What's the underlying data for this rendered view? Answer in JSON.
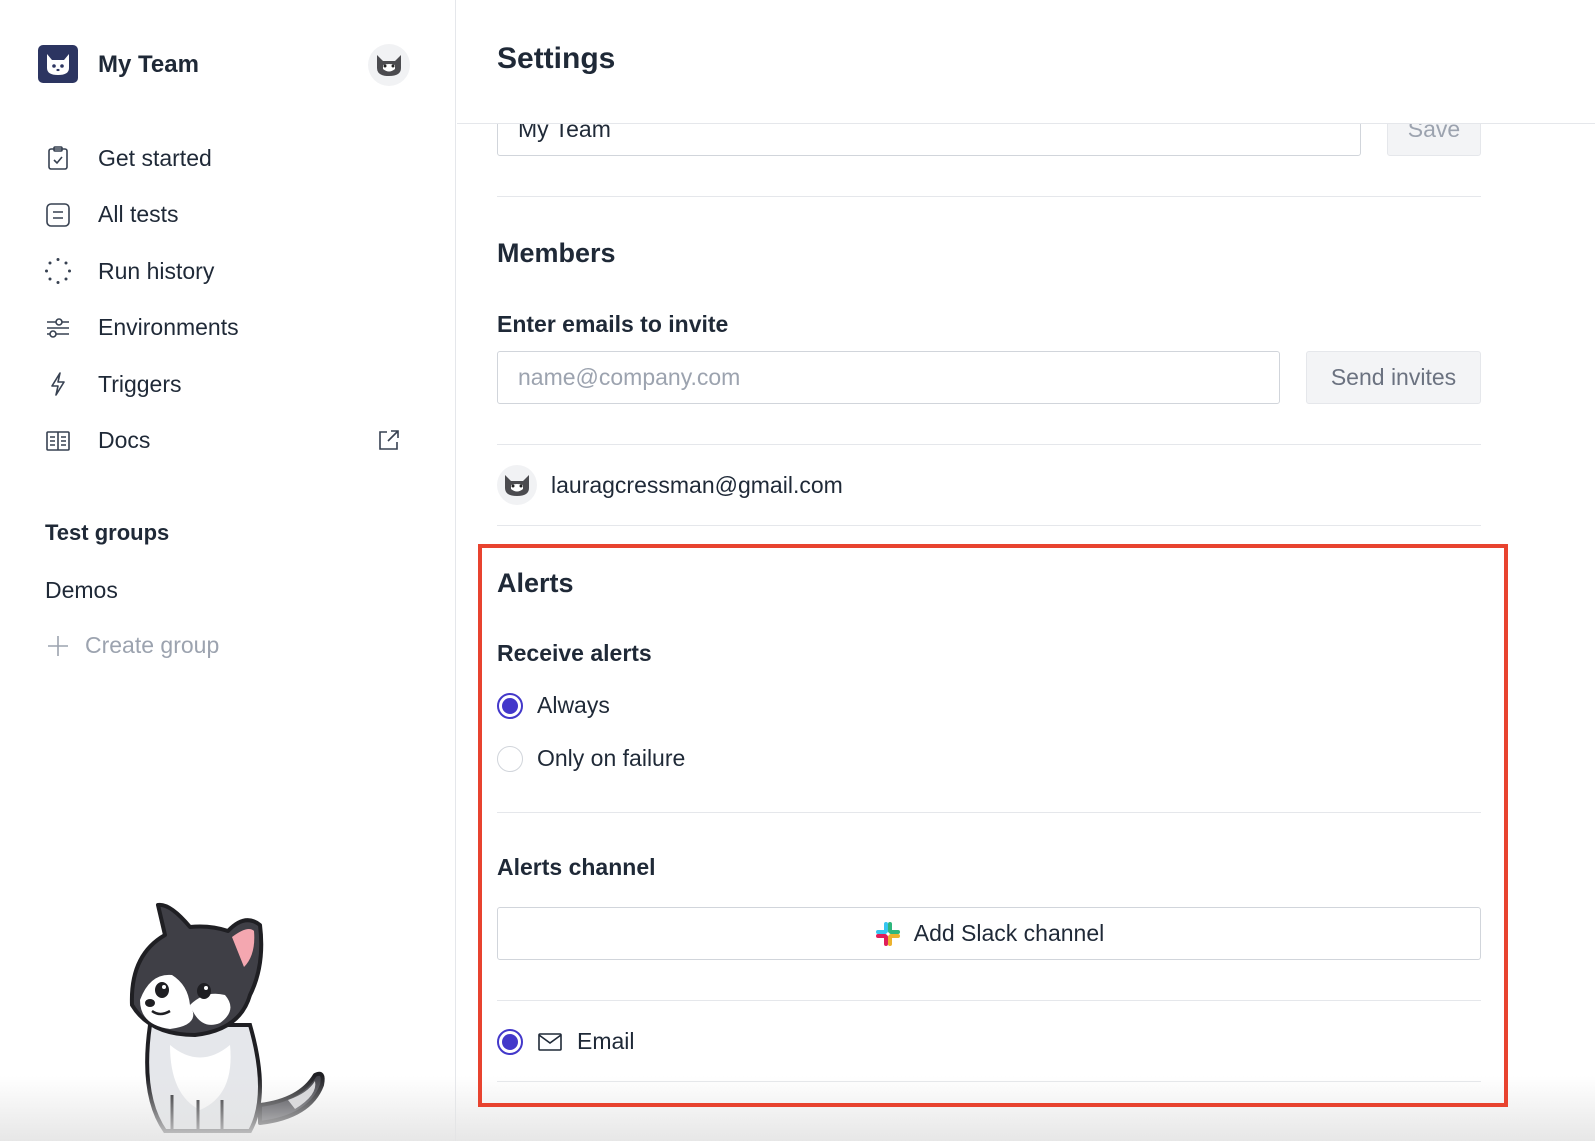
{
  "sidebar": {
    "team_name": "My Team",
    "nav": [
      {
        "label": "Get started",
        "icon": "clipboard-check-icon"
      },
      {
        "label": "All tests",
        "icon": "list-icon"
      },
      {
        "label": "Run history",
        "icon": "loader-dots-icon"
      },
      {
        "label": "Environments",
        "icon": "sliders-icon"
      },
      {
        "label": "Triggers",
        "icon": "lightning-icon"
      },
      {
        "label": "Docs",
        "icon": "book-icon",
        "external": true
      }
    ],
    "groups_heading": "Test groups",
    "groups": [
      "Demos"
    ],
    "create_group_label": "Create group"
  },
  "main": {
    "page_title": "Settings",
    "team_name_value": "My Team",
    "save_label": "Save",
    "members": {
      "title": "Members",
      "invite_label": "Enter emails to invite",
      "invite_placeholder": "name@company.com",
      "send_label": "Send invites",
      "list": [
        "lauragcressman@gmail.com"
      ]
    },
    "alerts": {
      "title": "Alerts",
      "receive_label": "Receive alerts",
      "options": [
        {
          "label": "Always",
          "checked": true
        },
        {
          "label": "Only on failure",
          "checked": false
        }
      ],
      "channel_label": "Alerts channel",
      "slack_label": "Add Slack channel",
      "email_label": "Email"
    }
  },
  "colors": {
    "accent": "#4338ca",
    "highlight": "#e8432f",
    "logo_bg": "#2c3561"
  }
}
